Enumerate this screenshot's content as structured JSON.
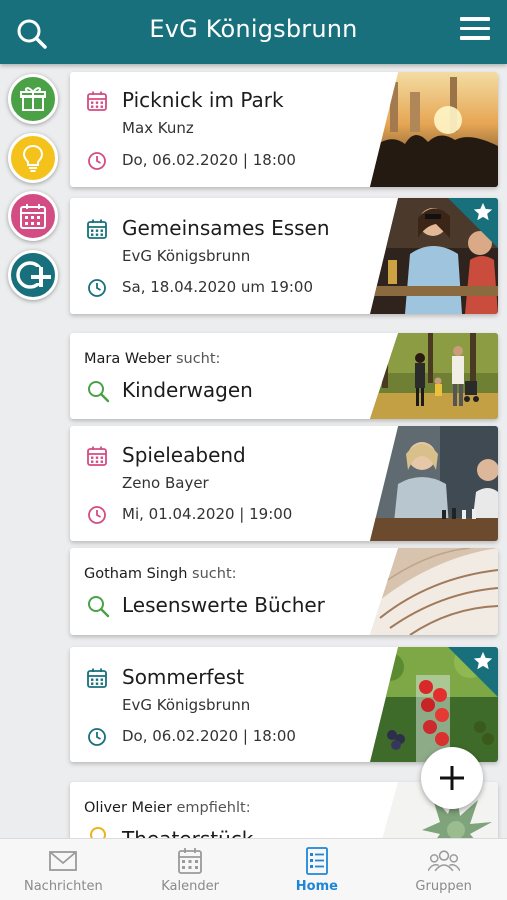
{
  "header": {
    "title": "EvG Königsbrunn",
    "search_icon": "search-icon",
    "menu_icon": "hamburger-menu-icon"
  },
  "rail": [
    {
      "icon": "gift-icon",
      "color": "#4aa146"
    },
    {
      "icon": "lightbulb-icon",
      "color": "#f5c21b"
    },
    {
      "icon": "calendar-icon",
      "color": "#d44c84"
    },
    {
      "icon": "group-plus-icon",
      "color": "#17707c"
    }
  ],
  "feed": {
    "e1": {
      "title": "Picknick im Park",
      "organizer": "Max Kunz",
      "date": "Do, 06.02.2020 | 18:00",
      "color": "#d44c84"
    },
    "e2": {
      "title": "Gemeinsames Essen",
      "organizer": "EvG Königsbrunn",
      "date": "Sa, 18.04.2020 um 19:00",
      "color": "#17707c",
      "featured": true
    },
    "s1": {
      "person": "Mara Weber",
      "verb": "sucht:",
      "title": "Kinderwagen",
      "color": "#4aa146"
    },
    "e3": {
      "title": "Spieleabend",
      "organizer": "Zeno Bayer",
      "date": "Mi, 01.04.2020 | 19:00",
      "color": "#d44c84"
    },
    "s2": {
      "person": "Gotham Singh",
      "verb": "sucht:",
      "title": "Lesenswerte Bücher",
      "color": "#4aa146"
    },
    "e4": {
      "title": "Sommerfest",
      "organizer": "EvG Königsbrunn",
      "date": "Do, 06.02.2020 | 18:00",
      "color": "#17707c",
      "featured": true
    },
    "r1": {
      "person": "Oliver Meier",
      "verb": "empfiehlt:",
      "title": "Theaterstück",
      "color": "#f5c21b"
    }
  },
  "fab": {
    "icon": "plus-icon"
  },
  "nav": {
    "items": [
      {
        "label": "Nachrichten",
        "icon": "mail-icon"
      },
      {
        "label": "Kalender",
        "icon": "calendar-icon"
      },
      {
        "label": "Home",
        "icon": "home-list-icon",
        "active": true
      },
      {
        "label": "Gruppen",
        "icon": "groups-icon"
      }
    ],
    "active_color": "#1f86d6"
  }
}
